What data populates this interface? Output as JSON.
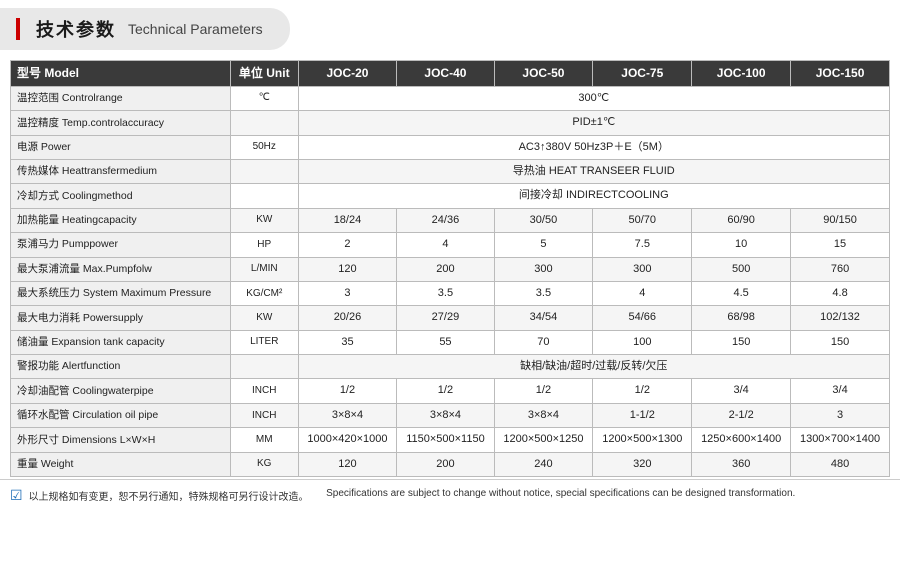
{
  "header": {
    "zh_label": "技术参数",
    "en_label": "Technical Parameters"
  },
  "table": {
    "columns": [
      "型号 Model",
      "单位 Unit",
      "JOC-20",
      "JOC-40",
      "JOC-50",
      "JOC-75",
      "JOC-100",
      "JOC-150"
    ],
    "rows": [
      {
        "label": "温控范围 Controlrange",
        "unit": "℃",
        "span": true,
        "span_value": "300℃"
      },
      {
        "label": "温控精度 Temp.controlaccuracy",
        "unit": "",
        "span": true,
        "span_value": "PID±1℃"
      },
      {
        "label": "电源 Power",
        "unit": "50Hz",
        "span": true,
        "span_value": "AC3↑380V 50Hz3P＋E（5M）"
      },
      {
        "label": "传热媒体 Heattransfermedium",
        "unit": "",
        "span": true,
        "span_value": "导热油 HEAT TRANSEER FLUID"
      },
      {
        "label": "冷却方式 Coolingmethod",
        "unit": "",
        "span": true,
        "span_value": "间接冷却 INDIRECTCOOLING"
      },
      {
        "label": "加热能量 Heatingcapacity",
        "unit": "KW",
        "span": false,
        "values": [
          "18/24",
          "24/36",
          "30/50",
          "50/70",
          "60/90",
          "90/150"
        ]
      },
      {
        "label": "泵浦马力 Pumppower",
        "unit": "HP",
        "span": false,
        "values": [
          "2",
          "4",
          "5",
          "7.5",
          "10",
          "15"
        ]
      },
      {
        "label": "最大泵浦流量 Max.Pumpfolw",
        "unit": "L/MIN",
        "span": false,
        "values": [
          "120",
          "200",
          "300",
          "300",
          "500",
          "760"
        ]
      },
      {
        "label": "最大系统压力 System Maximum Pressure",
        "unit": "KG/CM²",
        "span": false,
        "values": [
          "3",
          "3.5",
          "3.5",
          "4",
          "4.5",
          "4.8"
        ]
      },
      {
        "label": "最大电力消耗 Powersupply",
        "unit": "KW",
        "span": false,
        "values": [
          "20/26",
          "27/29",
          "34/54",
          "54/66",
          "68/98",
          "102/132"
        ]
      },
      {
        "label": "储油量 Expansion tank capacity",
        "unit": "LITER",
        "span": false,
        "values": [
          "35",
          "55",
          "70",
          "100",
          "150",
          "150"
        ]
      },
      {
        "label": "警报功能 Alertfunction",
        "unit": "",
        "span": true,
        "span_value": "缺相/缺油/超时/过载/反转/欠压"
      },
      {
        "label": "冷却油配管 Coolingwaterpipe",
        "unit": "INCH",
        "span": false,
        "values": [
          "1/2",
          "1/2",
          "1/2",
          "1/2",
          "3/4",
          "3/4"
        ]
      },
      {
        "label": "循环水配管 Circulation oil pipe",
        "unit": "INCH",
        "span": false,
        "values": [
          "3×8×4",
          "3×8×4",
          "3×8×4",
          "1-1/2",
          "2-1/2",
          "3"
        ]
      },
      {
        "label": "外形尺寸 Dimensions L×W×H",
        "unit": "MM",
        "span": false,
        "values": [
          "1000×420×1000",
          "1150×500×1150",
          "1200×500×1250",
          "1200×500×1300",
          "1250×600×1400",
          "1300×700×1400"
        ]
      },
      {
        "label": "重量 Weight",
        "unit": "KG",
        "span": false,
        "values": [
          "120",
          "200",
          "240",
          "320",
          "360",
          "480"
        ]
      }
    ]
  },
  "footer": {
    "zh_note": "以上规格如有变更，恕不另行通知，特殊规格可另行设计改造。",
    "en_note": "Specifications are subject to change without notice, special specifications can be designed transformation."
  }
}
